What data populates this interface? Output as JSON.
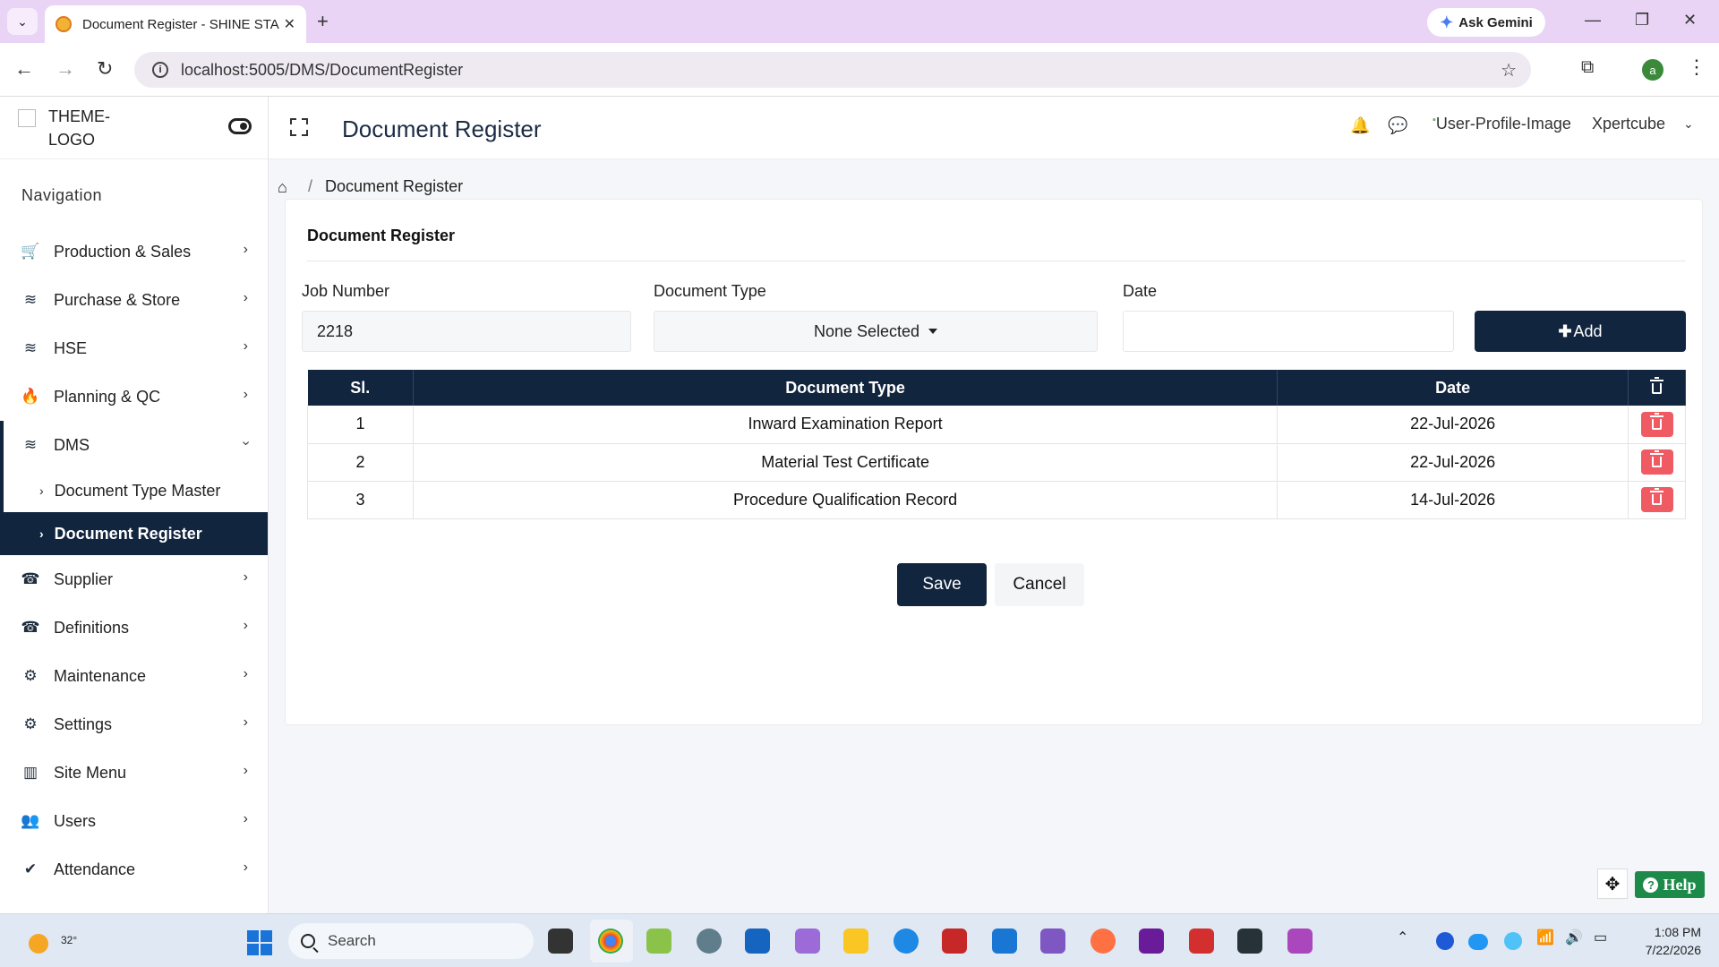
{
  "browser": {
    "tab_title": "Document Register - SHINE STA",
    "url": "localhost:5005/DMS/DocumentRegister",
    "gemini_label": "Ask Gemini",
    "profile_initial": "a"
  },
  "sidebar": {
    "logo_text": "THEME-LOGO",
    "heading": "Navigation",
    "items": [
      {
        "label": "Production & Sales",
        "icon": "cart-icon"
      },
      {
        "label": "Purchase & Store",
        "icon": "database-icon"
      },
      {
        "label": "HSE",
        "icon": "database-icon"
      },
      {
        "label": "Planning & QC",
        "icon": "fire-icon"
      },
      {
        "label": "DMS",
        "icon": "database-icon"
      },
      {
        "label": "Supplier",
        "icon": "tty-icon"
      },
      {
        "label": "Definitions",
        "icon": "tty-icon"
      },
      {
        "label": "Maintenance",
        "icon": "cogs-icon"
      },
      {
        "label": "Settings",
        "icon": "cogs-icon"
      },
      {
        "label": "Site Menu",
        "icon": "bar-chart-icon"
      },
      {
        "label": "Users",
        "icon": "users-icon"
      },
      {
        "label": "Attendance",
        "icon": "check-icon"
      }
    ],
    "dms_sub": [
      {
        "label": "Document Type Master"
      },
      {
        "label": "Document Register"
      }
    ]
  },
  "header": {
    "title": "Document Register",
    "user_image_alt": "User-Profile-Image",
    "user_name": "Xpertcube"
  },
  "breadcrumb": {
    "current": "Document Register"
  },
  "form": {
    "card_title": "Document Register",
    "job_number_label": "Job Number",
    "job_number_value": "2218",
    "document_type_label": "Document Type",
    "document_type_value": "None Selected",
    "date_label": "Date",
    "date_value": "",
    "add_label": "Add"
  },
  "table": {
    "headers": [
      "Sl.",
      "Document Type",
      "Date"
    ],
    "rows": [
      {
        "sl": "1",
        "type": "Inward Examination Report",
        "date": "22-Jul-2026"
      },
      {
        "sl": "2",
        "type": "Material Test Certificate",
        "date": "22-Jul-2026"
      },
      {
        "sl": "3",
        "type": "Procedure Qualification Record",
        "date": "14-Jul-2026"
      }
    ]
  },
  "actions": {
    "save": "Save",
    "cancel": "Cancel",
    "help": "Help"
  },
  "taskbar": {
    "temperature": "32°",
    "search_placeholder": "Search",
    "time": "1:08 PM",
    "date": "7/22/2026"
  },
  "colors": {
    "primary": "#12253f",
    "danger": "#f05a63",
    "help": "#1e8a4a"
  }
}
